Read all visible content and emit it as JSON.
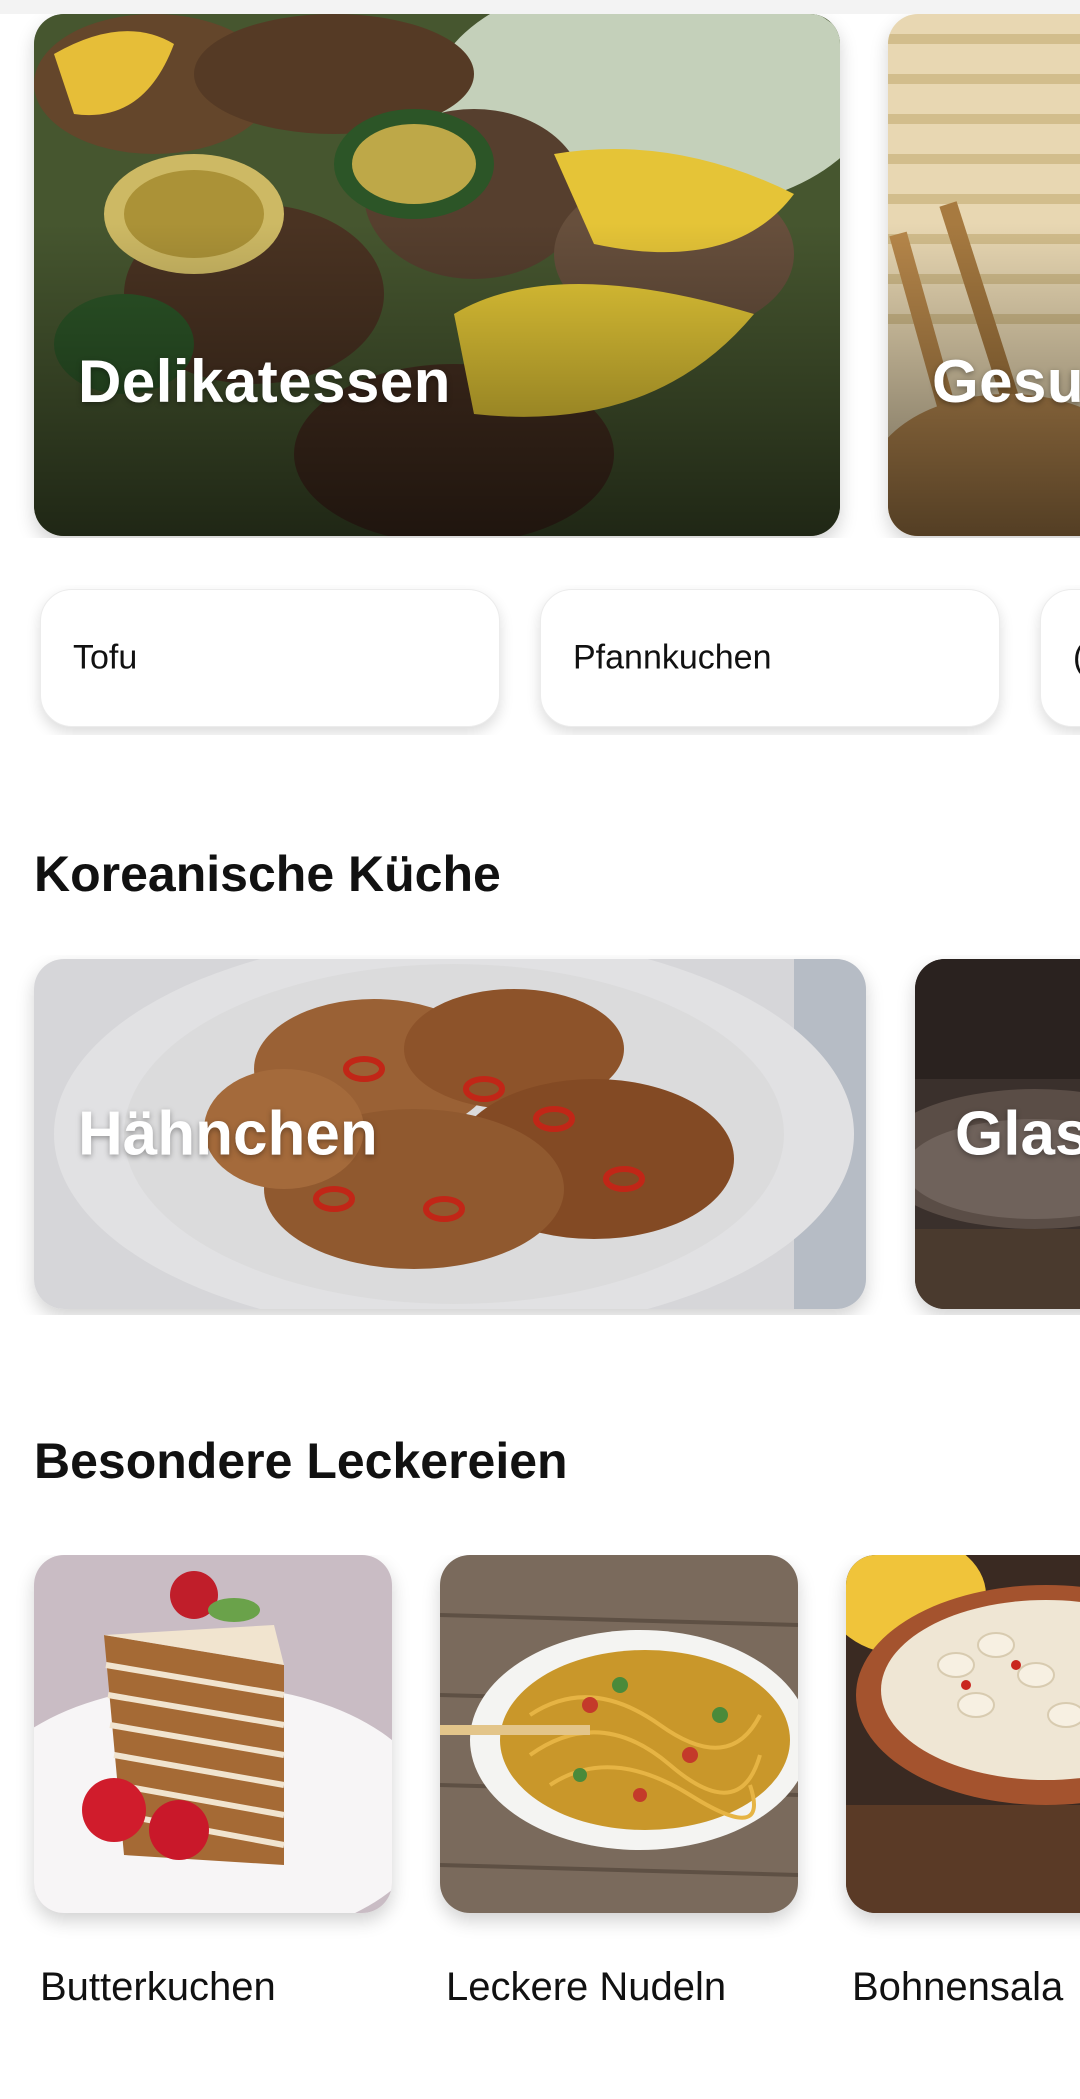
{
  "hero_cards": [
    {
      "label": "Delikatessen"
    },
    {
      "label": "Gesu"
    }
  ],
  "chips": [
    {
      "label": "Tofu"
    },
    {
      "label": "Pfannkuchen"
    },
    {
      "label": "("
    }
  ],
  "sections": {
    "korean_title": "Koreanische Küche",
    "specials_title": "Besondere Leckereien"
  },
  "korean_cards": [
    {
      "label": "Hähnchen"
    },
    {
      "label": "Glas"
    }
  ],
  "specials": [
    {
      "label": "Butterkuchen"
    },
    {
      "label": "Leckere Nudeln"
    },
    {
      "label": "Bohnensala"
    }
  ]
}
